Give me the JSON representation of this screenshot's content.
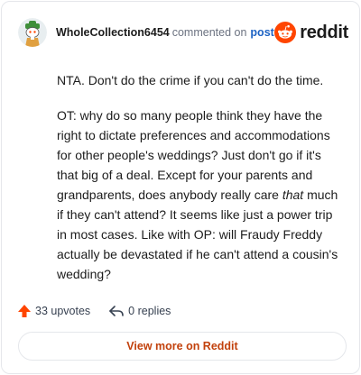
{
  "comment": {
    "username": "WholeCollection6454",
    "commented_on": "commented on",
    "post_link": "post",
    "brand": "reddit",
    "paragraph1": "NTA. Don't do the crime if you can't do the time.",
    "paragraph2_before_em": "OT: why do so many people think they have the right to dictate preferences and accommodations for other people's weddings? Just don't go if it's that big of a deal. Except for your parents and grandparents, does anybody really care ",
    "paragraph2_em": "that",
    "paragraph2_after_em": " much if they can't attend? It seems like just a power trip in most cases. Like with OP: will Fraudy Freddy actually be devastated if he can't attend a cousin's wedding?"
  },
  "footer": {
    "upvotes": "33 upvotes",
    "replies": "0 replies",
    "view_more": "View more on Reddit"
  },
  "icons": {
    "avatar": "snoo-avatar",
    "reddit_logo": "reddit-logo-icon",
    "upvote": "upvote-arrow-icon",
    "reply": "reply-arrow-icon"
  },
  "colors": {
    "reddit_orange": "#ff4500",
    "link_blue": "#1e63c4",
    "view_more": "#c2410c"
  }
}
